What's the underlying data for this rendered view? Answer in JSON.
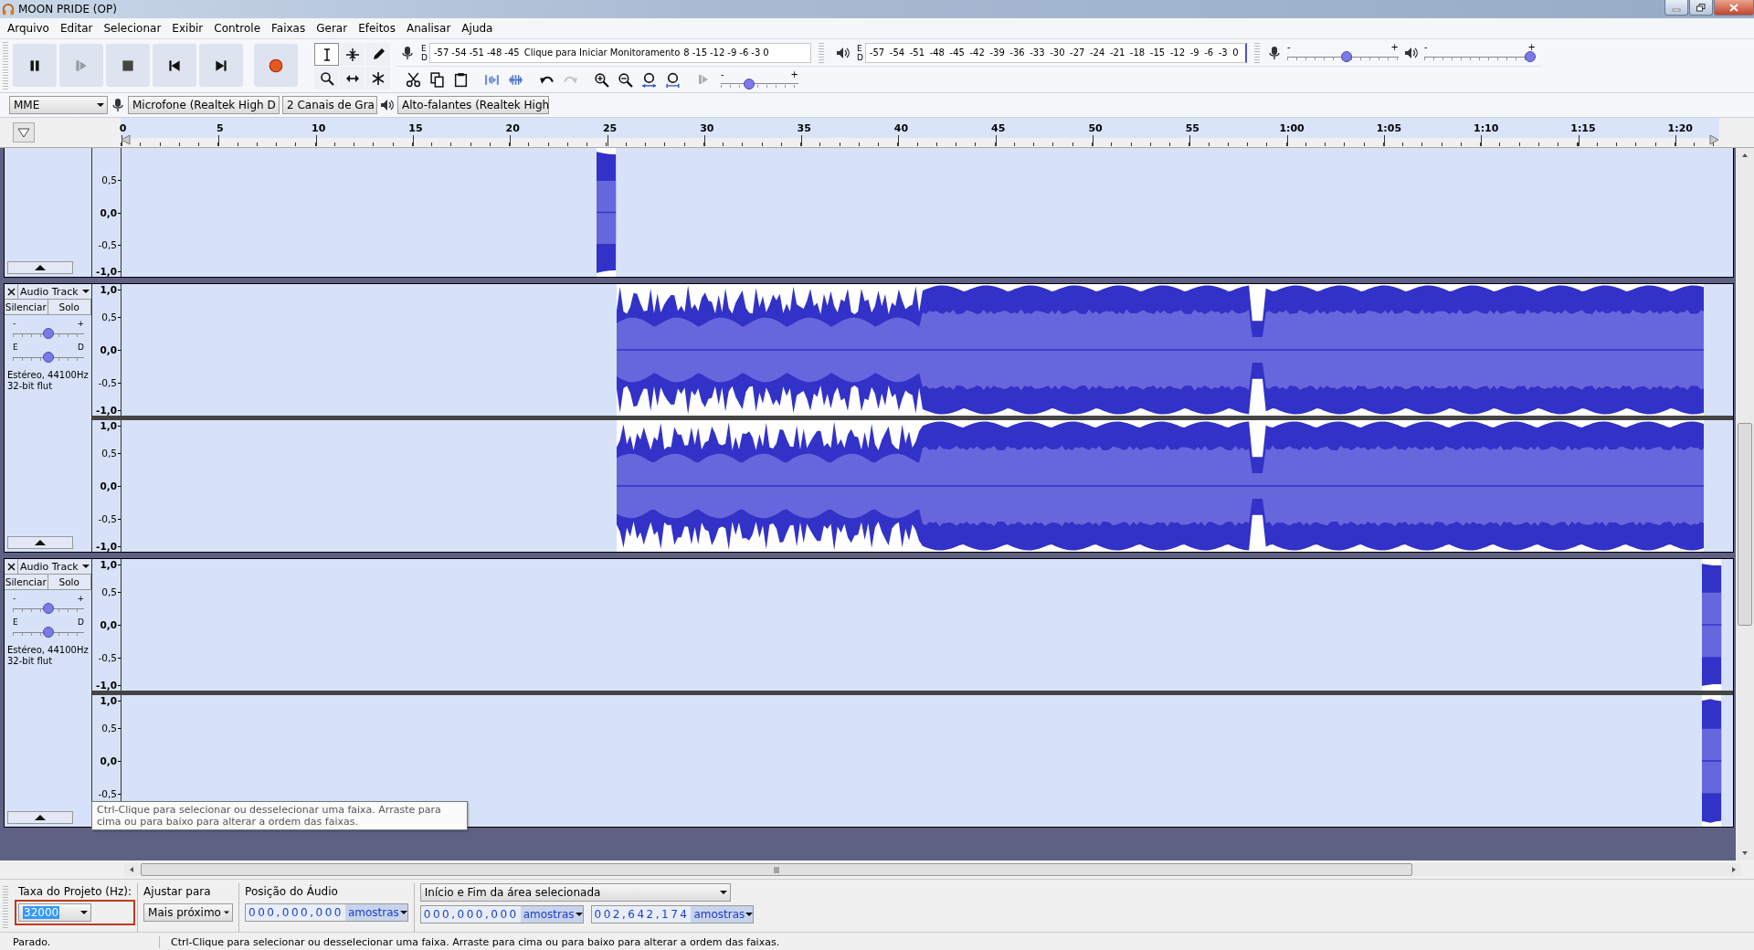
{
  "window": {
    "title": "MOON PRIDE (OP)"
  },
  "menu": [
    "Arquivo",
    "Editar",
    "Selecionar",
    "Exibir",
    "Controle",
    "Faixas",
    "Gerar",
    "Efeitos",
    "Analisar",
    "Ajuda"
  ],
  "transport": [
    {
      "kind": "pause",
      "disabled": false
    },
    {
      "kind": "play",
      "disabled": true
    },
    {
      "kind": "stop",
      "disabled": false
    },
    {
      "kind": "skip_start",
      "disabled": false
    },
    {
      "kind": "skip_end",
      "disabled": false
    },
    {
      "kind": "record",
      "disabled": false
    }
  ],
  "tools": [
    {
      "kind": "select",
      "selected": true
    },
    {
      "kind": "envelope",
      "selected": false
    },
    {
      "kind": "draw",
      "selected": false
    },
    {
      "kind": "zoom",
      "selected": false
    },
    {
      "kind": "timeshift",
      "selected": false
    },
    {
      "kind": "multi",
      "selected": false
    }
  ],
  "record_meter": {
    "channels": [
      "E",
      "D"
    ],
    "ticks": [
      "-57",
      "-54",
      "-51",
      "-48",
      "-45"
    ],
    "hint": "Clique para Iniciar Monitoramento",
    "ticks_after": [
      "8",
      "-15",
      "-12",
      "-9",
      "-6",
      "-3",
      "0"
    ]
  },
  "play_meter": {
    "channels": [
      "E",
      "D"
    ],
    "ticks": [
      "-57",
      "-54",
      "-51",
      "-48",
      "-45",
      "-42",
      "-39",
      "-36",
      "-33",
      "-30",
      "-27",
      "-24",
      "-21",
      "-18",
      "-15",
      "-12",
      "-9",
      "-6",
      "-3",
      "0"
    ]
  },
  "mixer": {
    "record": {
      "min": "-",
      "max": "+",
      "level": 0.54
    },
    "playback": {
      "min": "-",
      "max": "+",
      "level": 1.0
    }
  },
  "edit_tools": [
    {
      "kind": "cut",
      "disabled": false
    },
    {
      "kind": "copy",
      "disabled": false
    },
    {
      "kind": "paste",
      "disabled": false
    },
    {
      "kind": "trim",
      "disabled": false
    },
    {
      "kind": "silence",
      "disabled": false
    },
    {
      "kind": "undo",
      "disabled": false
    },
    {
      "kind": "redo",
      "disabled": true
    },
    {
      "kind": "zoom_in",
      "disabled": false
    },
    {
      "kind": "zoom_out",
      "disabled": false
    },
    {
      "kind": "fit_selection",
      "disabled": false
    },
    {
      "kind": "fit_project",
      "disabled": false
    }
  ],
  "play_at_speed": {
    "disabled": true,
    "min": "-",
    "max": "+",
    "level": 0.34
  },
  "devices": {
    "host": "MME",
    "input": "Microfone (Realtek High D",
    "channels": "2 Canais de  Gra",
    "output": "Alto-falantes (Realtek High"
  },
  "ruler": {
    "labels": [
      "0",
      "5",
      "10",
      "15",
      "20",
      "25",
      "30",
      "35",
      "40",
      "45",
      "50",
      "55",
      "1:00",
      "1:05",
      "1:10",
      "1:15",
      "1:20"
    ]
  },
  "tracks": [
    {
      "clipped_top": true,
      "channels": [
        {
          "scale": [
            "0,5",
            "0,0",
            "-0,5",
            "-1,0"
          ]
        }
      ]
    },
    {
      "clipped_top": false,
      "name": "Audio Track",
      "mute": "Silenciar",
      "solo": "Solo",
      "gain": {
        "min": "-",
        "max": "+",
        "level": 0.5
      },
      "pan": {
        "left": "E",
        "right": "D",
        "level": 0.5
      },
      "info": [
        "Estéreo, 44100Hz",
        "32-bit flut"
      ],
      "channels": [
        {
          "scale": [
            "1,0",
            "0,5",
            "0,0",
            "-0,5",
            "-1,0"
          ]
        },
        {
          "scale": [
            "1,0",
            "0,5",
            "0,0",
            "-0,5",
            "-1,0"
          ]
        }
      ]
    },
    {
      "clipped_top": false,
      "name": "Audio Track",
      "mute": "Silenciar",
      "solo": "Solo",
      "gain": {
        "min": "-",
        "max": "+",
        "level": 0.5
      },
      "pan": {
        "left": "E",
        "right": "D",
        "level": 0.5
      },
      "info": [
        "Estéreo, 44100Hz",
        "32-bit flut"
      ],
      "channels": [
        {
          "scale": [
            "1,0",
            "0,5",
            "0,0",
            "-0,5",
            "-1,0"
          ]
        },
        {
          "scale": [
            "1,0",
            "0,5",
            "0,0",
            "-0,5"
          ]
        }
      ]
    }
  ],
  "tooltip": "Ctrl-Clique para selecionar ou desselecionar uma faixa. Arraste para cima ou para baixo para alterar a ordem das faixas.",
  "selection_bar": {
    "rate_label": "Taxa do Projeto (Hz):",
    "rate": "32000",
    "rate_text_selected": true,
    "rate_highlighted": true,
    "snap_label": "Ajustar para",
    "snap": "Mais próximo",
    "position_label": "Posição do Áudio",
    "position": {
      "digits": "000,000,000",
      "unit": "amostras"
    },
    "mode": "Início e Fim da área selecionada",
    "start": {
      "digits": "000,000,000",
      "unit": "amostras"
    },
    "end": {
      "digits": "002,642,174",
      "unit": "amostras"
    }
  },
  "status": {
    "state": "Parado.",
    "message": "Ctrl-Clique para selecionar ou desselecionar uma faixa. Arraste para cima ou para baixo para alterar a ordem das faixas."
  }
}
